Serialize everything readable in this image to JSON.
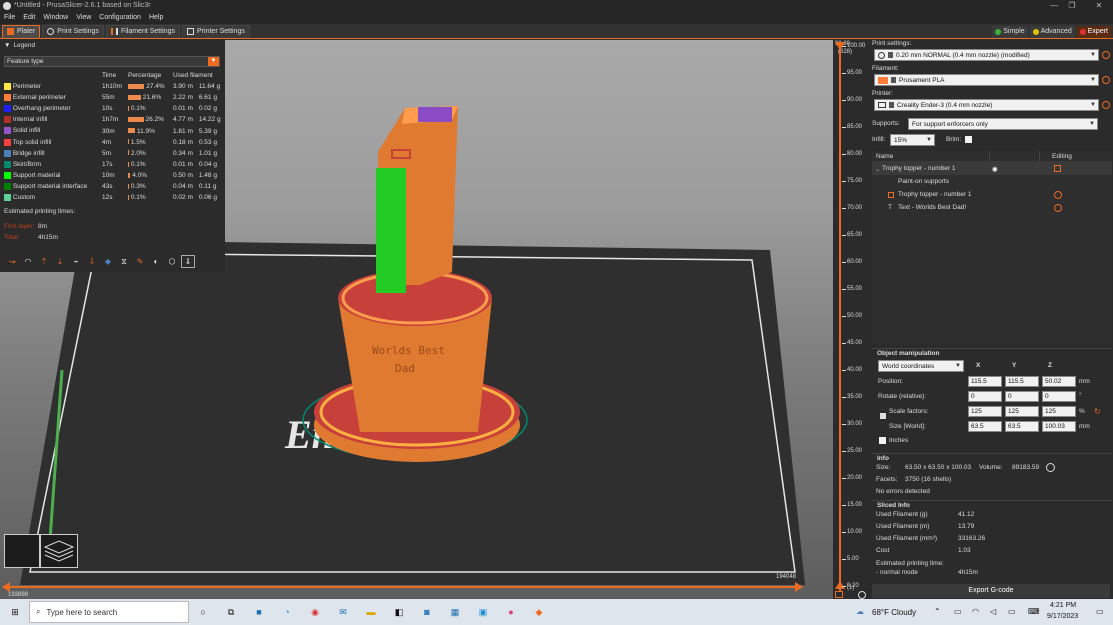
{
  "window": {
    "title": "*Untitled - PrusaSlicer-2.6.1 based on Slic3r",
    "min": "—",
    "max": "❐",
    "close": "✕"
  },
  "menu": [
    "File",
    "Edit",
    "Window",
    "View",
    "Configuration",
    "Help"
  ],
  "tabs": [
    {
      "label": "Plater"
    },
    {
      "label": "Print Settings"
    },
    {
      "label": "Filament Settings"
    },
    {
      "label": "Printer Settings"
    }
  ],
  "modes": [
    {
      "label": "Simple",
      "color": "#3bb33b"
    },
    {
      "label": "Advanced",
      "color": "#e6c300"
    },
    {
      "label": "Expert",
      "color": "#e03030"
    }
  ],
  "legend": {
    "title": "Legend",
    "view_type": "Feature type",
    "headers": [
      "Time",
      "Percentage",
      "Used filament"
    ],
    "rows": [
      {
        "name": "Perimeter",
        "color": "#ffe645",
        "time": "1h10m",
        "pct": "27.4%",
        "pct_val": 27.4,
        "len": "3.90 m",
        "weight": "11.64 g"
      },
      {
        "name": "External perimeter",
        "color": "#ff7d38",
        "time": "55m",
        "pct": "21.6%",
        "pct_val": 21.6,
        "len": "2.22 m",
        "weight": "6.61 g"
      },
      {
        "name": "Overhang perimeter",
        "color": "#1f1fff",
        "time": "10s",
        "pct": "0.1%",
        "pct_val": 0.1,
        "len": "0.01 m",
        "weight": "0.02 g"
      },
      {
        "name": "Internal infill",
        "color": "#b03029",
        "time": "1h7m",
        "pct": "26.2%",
        "pct_val": 26.2,
        "len": "4.77 m",
        "weight": "14.22 g"
      },
      {
        "name": "Solid infill",
        "color": "#9654cc",
        "time": "30m",
        "pct": "11.9%",
        "pct_val": 11.9,
        "len": "1.81 m",
        "weight": "5.39 g"
      },
      {
        "name": "Top solid infill",
        "color": "#f04040",
        "time": "4m",
        "pct": "1.5%",
        "pct_val": 1.5,
        "len": "0.18 m",
        "weight": "0.53 g"
      },
      {
        "name": "Bridge infill",
        "color": "#4d80ba",
        "time": "5m",
        "pct": "2.0%",
        "pct_val": 2.0,
        "len": "0.34 m",
        "weight": "1.01 g"
      },
      {
        "name": "Skirt/Brim",
        "color": "#00876e",
        "time": "17s",
        "pct": "0.1%",
        "pct_val": 0.1,
        "len": "0.01 m",
        "weight": "0.04 g"
      },
      {
        "name": "Support material",
        "color": "#00ff00",
        "time": "10m",
        "pct": "4.0%",
        "pct_val": 4.0,
        "len": "0.50 m",
        "weight": "1.48 g"
      },
      {
        "name": "Support material interface",
        "color": "#008000",
        "time": "43s",
        "pct": "0.3%",
        "pct_val": 0.3,
        "len": "0.04 m",
        "weight": "0.11 g"
      },
      {
        "name": "Custom",
        "color": "#5ed194",
        "time": "12s",
        "pct": "0.1%",
        "pct_val": 0.1,
        "len": "0.02 m",
        "weight": "0.06 g"
      }
    ],
    "est_title": "Estimated printing times:",
    "first_layer_label": "First layer:",
    "first_layer": "8m",
    "total_label": "Total:",
    "total": "4h15m"
  },
  "print_settings": {
    "label": "Print settings:",
    "value": "0.20 mm NORMAL (0.4 mm nozzle) (modified)"
  },
  "filament": {
    "label": "Filament:",
    "value": "Prusament PLA",
    "color": "#ff7d38"
  },
  "printer": {
    "label": "Printer:",
    "value": "Creality Ender-3 (0.4 mm nozzle)"
  },
  "supports": {
    "label": "Supports:",
    "value": "For support enforcers only"
  },
  "infill": {
    "label": "Infill:",
    "value": "15%"
  },
  "brim": {
    "label": "Brim:"
  },
  "objects": {
    "headers": [
      "Name",
      "Editing"
    ],
    "rows": [
      {
        "name": "Trophy topper - number 1"
      },
      {
        "name": "Paint-on supports"
      },
      {
        "name": "Trophy topper - number 1"
      },
      {
        "name": "Text - Worlds Best  Dad!"
      }
    ]
  },
  "manip": {
    "title": "Object manipulation",
    "coord": "World coordinates",
    "axes": [
      "X",
      "Y",
      "Z"
    ],
    "position_label": "Position:",
    "position": [
      "115.5",
      "115.5",
      "50.02"
    ],
    "position_unit": "mm",
    "rotate_label": "Rotate (relative):",
    "rotate": [
      "0",
      "0",
      "0"
    ],
    "rotate_unit": "°",
    "scale_label": "Scale factors:",
    "scale": [
      "125",
      "125",
      "125"
    ],
    "scale_unit": "%",
    "size_label": "Size [World]:",
    "size": [
      "63.5",
      "63.5",
      "100.03"
    ],
    "size_unit": "mm",
    "inches": "Inches"
  },
  "info": {
    "title": "Info",
    "size_label": "Size:",
    "size": "63.50 x 63.50 x 100.03",
    "volume_label": "Volume:",
    "volume": "89183.59",
    "facets_label": "Facets:",
    "facets": "3750 (16 shells)",
    "errors": "No errors detected"
  },
  "sliced": {
    "title": "Sliced Info",
    "rows": [
      {
        "k": "Used Filament (g)",
        "v": "41.12"
      },
      {
        "k": "Used Filament (m)",
        "v": "13.79"
      },
      {
        "k": "Used Filament (mm³)",
        "v": "33163.26"
      },
      {
        "k": "Cost",
        "v": "1.03"
      }
    ],
    "est_label": "Estimated printing time:",
    "mode_label": "- normal mode",
    "mode_value": "4h15m"
  },
  "export_label": "Export G-code",
  "vslider": {
    "top_value": "99.80",
    "top_layer": "(628)",
    "ticks": [
      "100.00",
      "95.00",
      "90.00",
      "85.00",
      "80.00",
      "75.00",
      "70.00",
      "65.00",
      "60.00",
      "55.00",
      "50.00",
      "45.00",
      "40.00",
      "35.00",
      "30.00",
      "25.00",
      "20.00",
      "15.00",
      "10.00",
      "5.00",
      "0.20"
    ],
    "bottom_layer": "(1)"
  },
  "hslider": {
    "left": "193898",
    "right": "194048"
  },
  "model_text": "Worlds Best\nDad",
  "taskbar": {
    "search": "Type here to search",
    "weather": "68°F  Cloudy",
    "time": "4:21 PM",
    "date": "9/17/2023"
  }
}
